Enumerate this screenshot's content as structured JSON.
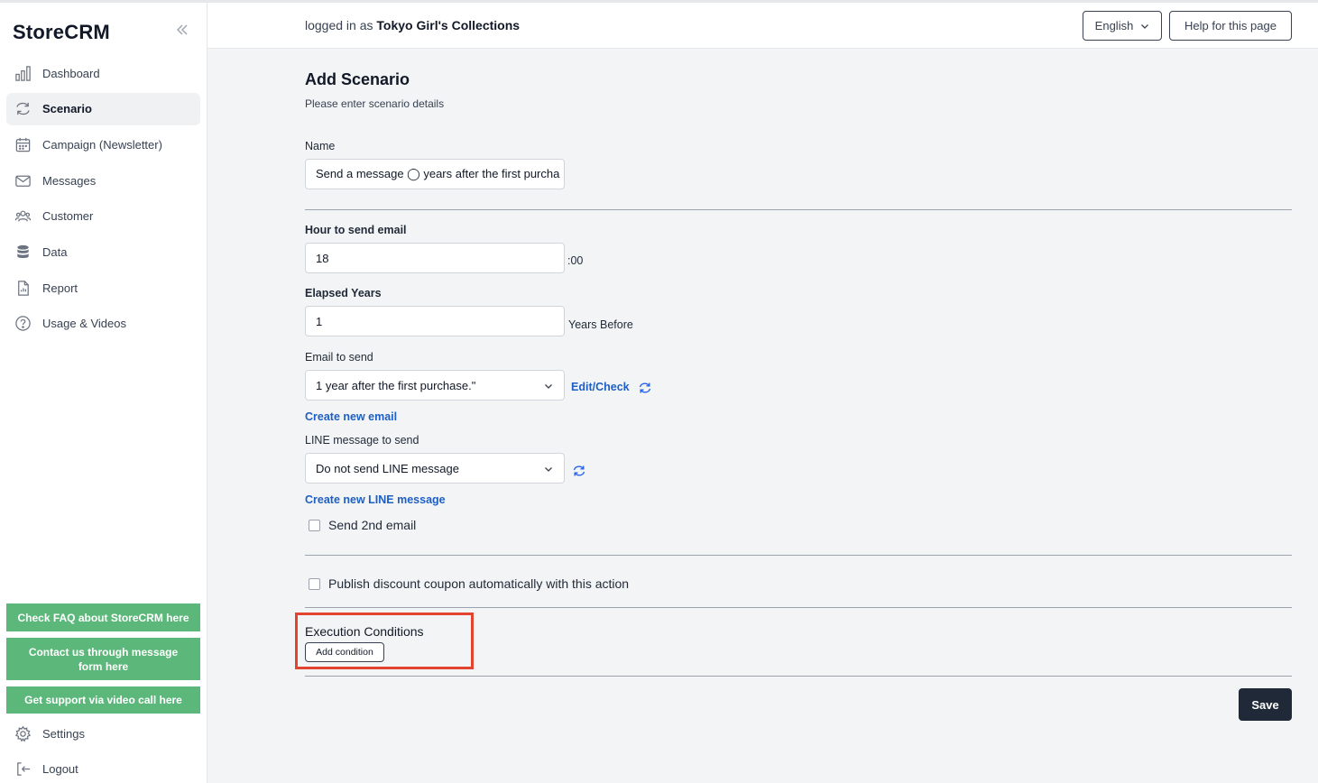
{
  "app": {
    "logo": "StoreCRM"
  },
  "sidebar": {
    "items": [
      {
        "label": "Dashboard",
        "icon": "bar-chart-icon"
      },
      {
        "label": "Scenario",
        "icon": "refresh-icon",
        "active": true
      },
      {
        "label": "Campaign (Newsletter)",
        "icon": "calendar-icon"
      },
      {
        "label": "Messages",
        "icon": "envelope-icon"
      },
      {
        "label": "Customer",
        "icon": "users-icon"
      },
      {
        "label": "Data",
        "icon": "database-icon"
      },
      {
        "label": "Report",
        "icon": "document-icon"
      },
      {
        "label": "Usage & Videos",
        "icon": "help-circle-icon"
      }
    ],
    "support_buttons": [
      "Check FAQ about StoreCRM here",
      "Contact us through message form here",
      "Get support via video call here"
    ],
    "settings_label": "Settings",
    "logout_label": "Logout"
  },
  "header": {
    "logged_prefix": "logged in as",
    "store_name": "Tokyo Girl's Collections",
    "language": "English",
    "help_label": "Help for this page"
  },
  "form": {
    "title": "Add Scenario",
    "subtitle": "Please enter scenario details",
    "name_label": "Name",
    "name_value": "Send a message ◯ years after the first purcha",
    "hour_label": "Hour to send email",
    "hour_value": "18",
    "hour_suffix": ":00",
    "elapsed_label": "Elapsed Years",
    "elapsed_value": "1",
    "elapsed_suffix": "Years Before",
    "email_label": "Email to send",
    "email_value": "1 year after the first purchase.\"",
    "edit_check_label": "Edit/Check",
    "create_email_label": "Create new email",
    "line_label": "LINE message to send",
    "line_value": "Do not send LINE message",
    "create_line_label": "Create new LINE message",
    "send_2nd_label": "Send 2nd email",
    "coupon_label": "Publish discount coupon automatically with this action",
    "exec_title": "Execution Conditions",
    "add_condition_label": "Add condition",
    "save_label": "Save"
  },
  "colors": {
    "accent_link": "#1d5fc4",
    "support_green": "#5cb87a",
    "save_dark": "#1f2937",
    "highlight_red": "#e2442f"
  }
}
